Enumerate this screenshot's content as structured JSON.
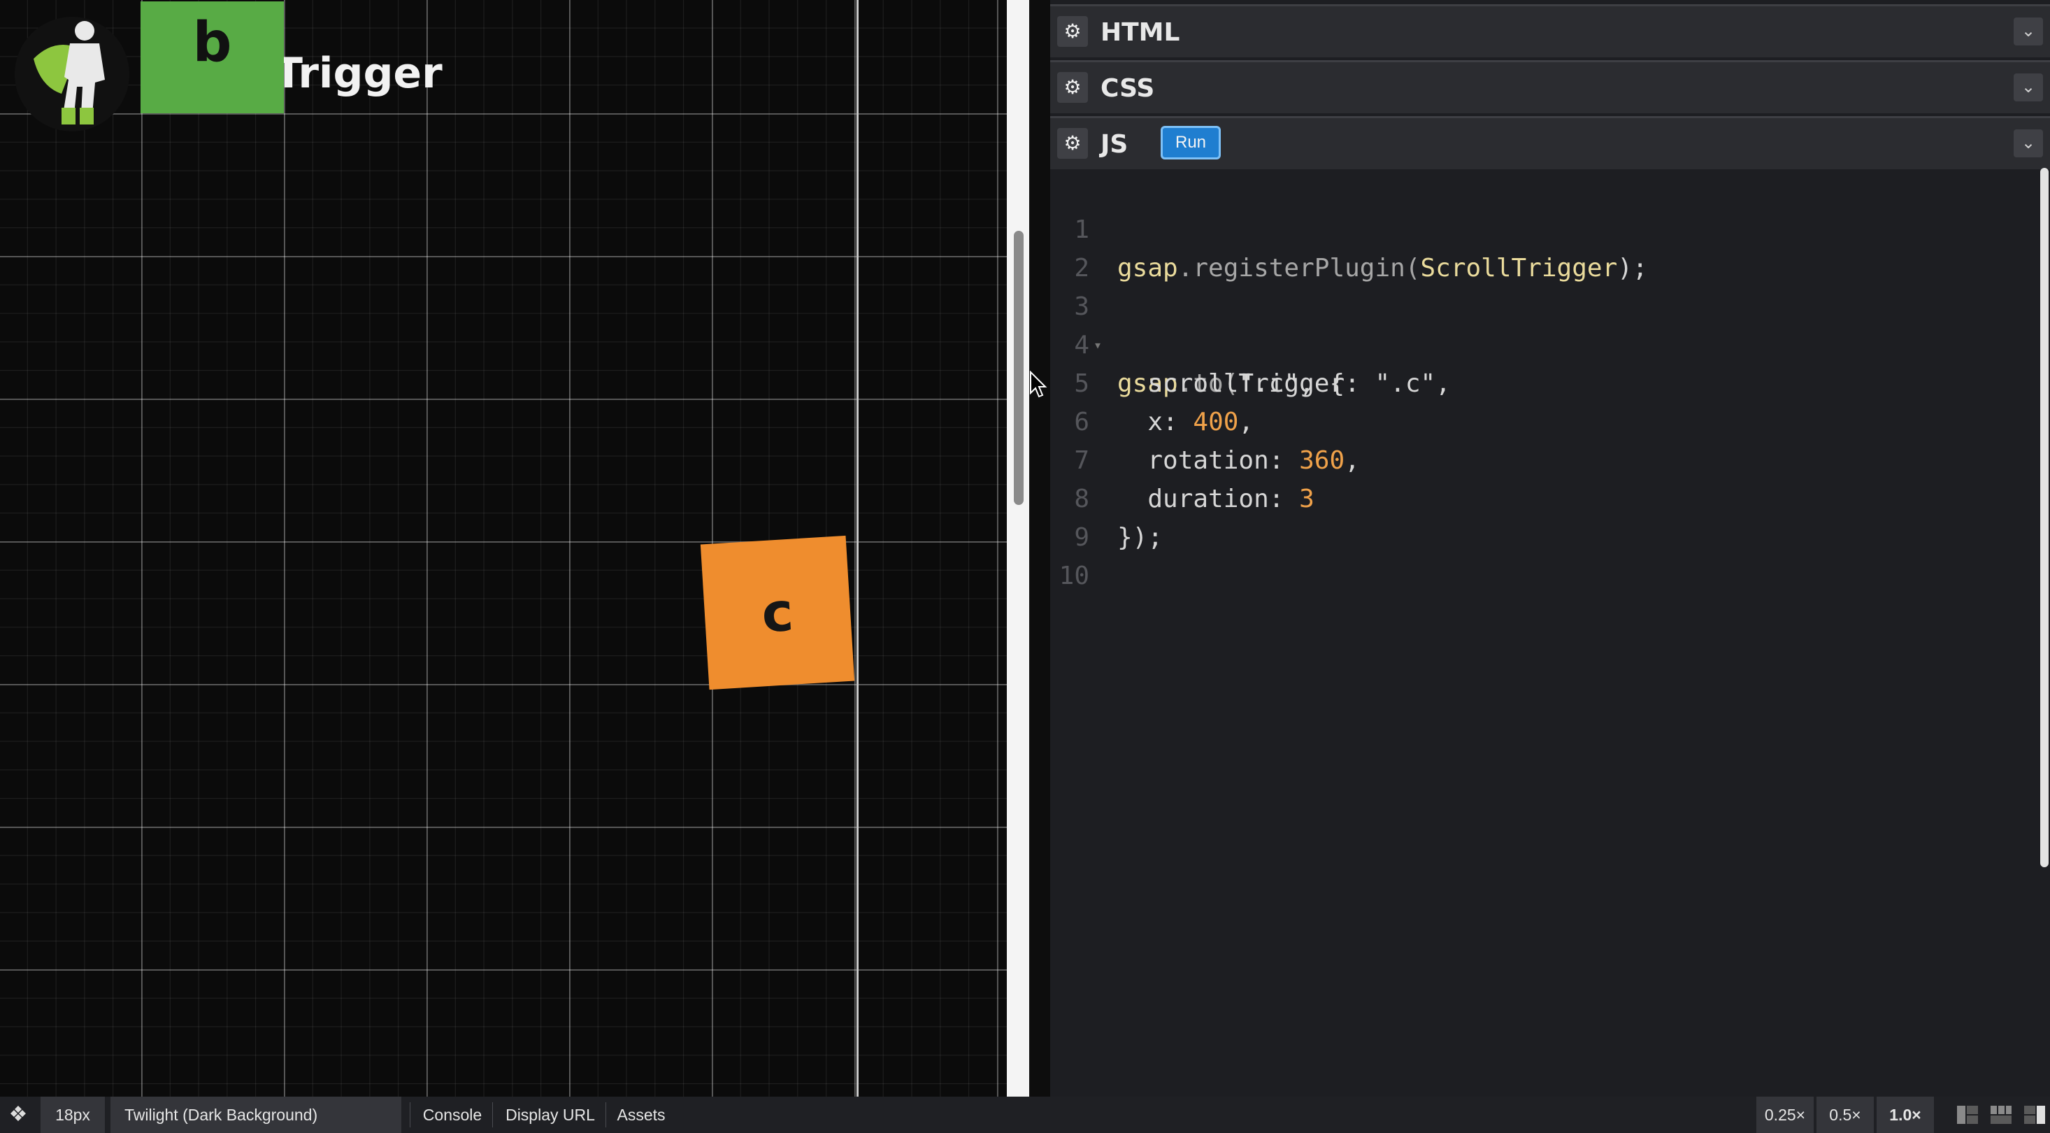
{
  "preview": {
    "box_b_label": "b",
    "title_partial": "Trigger",
    "box_c_label": "c"
  },
  "editor": {
    "panels": [
      {
        "title": "HTML"
      },
      {
        "title": "CSS"
      },
      {
        "title": "JS"
      }
    ],
    "run_label": "Run",
    "code_lines": [
      {
        "n": "1",
        "text": "gsap.registerPlugin(ScrollTrigger);"
      },
      {
        "n": "2",
        "text": ""
      },
      {
        "n": "3",
        "text": "gsap.to(\".c\", {"
      },
      {
        "n": "4",
        "text": "  scrollTrigger: \".c\","
      },
      {
        "n": "5",
        "text": "  x: 400,"
      },
      {
        "n": "6",
        "text": "  rotation: 360,"
      },
      {
        "n": "7",
        "text": "  duration: 3"
      },
      {
        "n": "8",
        "text": "});"
      },
      {
        "n": "9",
        "text": ""
      },
      {
        "n": "10",
        "text": ""
      }
    ]
  },
  "footer": {
    "font_size": "18px",
    "theme": "Twilight (Dark Background)",
    "console": "Console",
    "display_url": "Display URL",
    "assets": "Assets",
    "zoom_options": [
      "0.25×",
      "0.5×",
      "1.0×"
    ],
    "zoom_selected": "1.0×"
  },
  "icons": {
    "logo": "greensock-hero-logo",
    "panel_settings": "gear-icon",
    "panel_collapse": "chevron-down-icon",
    "codepen": "codepen-icon"
  },
  "colors": {
    "box_b": "#58ab45",
    "box_c": "#ef8d2e",
    "run_button": "#1f7ed0",
    "code_object": "#eadb9c",
    "code_number": "#f0a24a"
  }
}
